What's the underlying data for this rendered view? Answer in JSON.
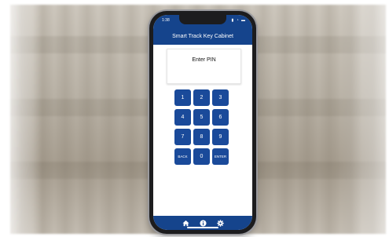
{
  "status_bar": {
    "time": "1:38",
    "icons": "▮ ◔ ▬"
  },
  "app": {
    "title": "Smart Track Key Cabinet"
  },
  "pin": {
    "prompt": "Enter PIN"
  },
  "keypad": {
    "k1": "1",
    "k2": "2",
    "k3": "3",
    "k4": "4",
    "k5": "5",
    "k6": "6",
    "k7": "7",
    "k8": "8",
    "k9": "9",
    "back": "BACK",
    "k0": "0",
    "enter": "ENTER"
  },
  "bottom_nav": {
    "items": [
      "home-icon",
      "info-icon",
      "gear-icon"
    ]
  },
  "colors": {
    "primary": "#15448c",
    "key": "#1a4a9a"
  }
}
